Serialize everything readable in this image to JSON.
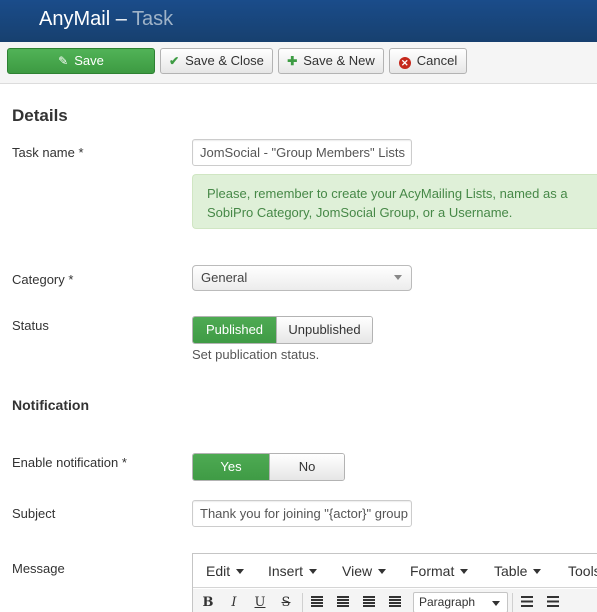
{
  "header": {
    "app_name": "AnyMail",
    "separator": "–",
    "view_name": "Task"
  },
  "toolbar": {
    "save": "Save",
    "save_close": "Save & Close",
    "save_new": "Save & New",
    "cancel": "Cancel"
  },
  "details": {
    "section_title": "Details",
    "task_name_label": "Task name *",
    "task_name_value": "JomSocial - \"Group Members\" Lists",
    "alert": "Please, remember to create your AcyMailing Lists, named as a SobiPro Category, JomSocial Group, or a Username.",
    "category_label": "Category *",
    "category_value": "General",
    "status_label": "Status",
    "status_options": [
      "Published",
      "Unpublished"
    ],
    "status_selected": "Published",
    "status_help": "Set publication status."
  },
  "notification": {
    "section_title": "Notification",
    "enable_label": "Enable notification *",
    "enable_options": [
      "Yes",
      "No"
    ],
    "enable_selected": "Yes",
    "subject_label": "Subject",
    "subject_value": "Thank you for joining \"{actor}\" group",
    "message_label": "Message"
  },
  "editor": {
    "menus": [
      "Edit",
      "Insert",
      "View",
      "Format",
      "Table",
      "Tools"
    ],
    "bold": "B",
    "italic": "I",
    "underline": "U",
    "strike": "S",
    "block_format": "Paragraph"
  },
  "colors": {
    "header_bg": "#1a4c8a",
    "primary_green": "#46a546",
    "alert_bg": "#dff0d8",
    "alert_text": "#468847",
    "cancel_icon": "#c5281c"
  }
}
